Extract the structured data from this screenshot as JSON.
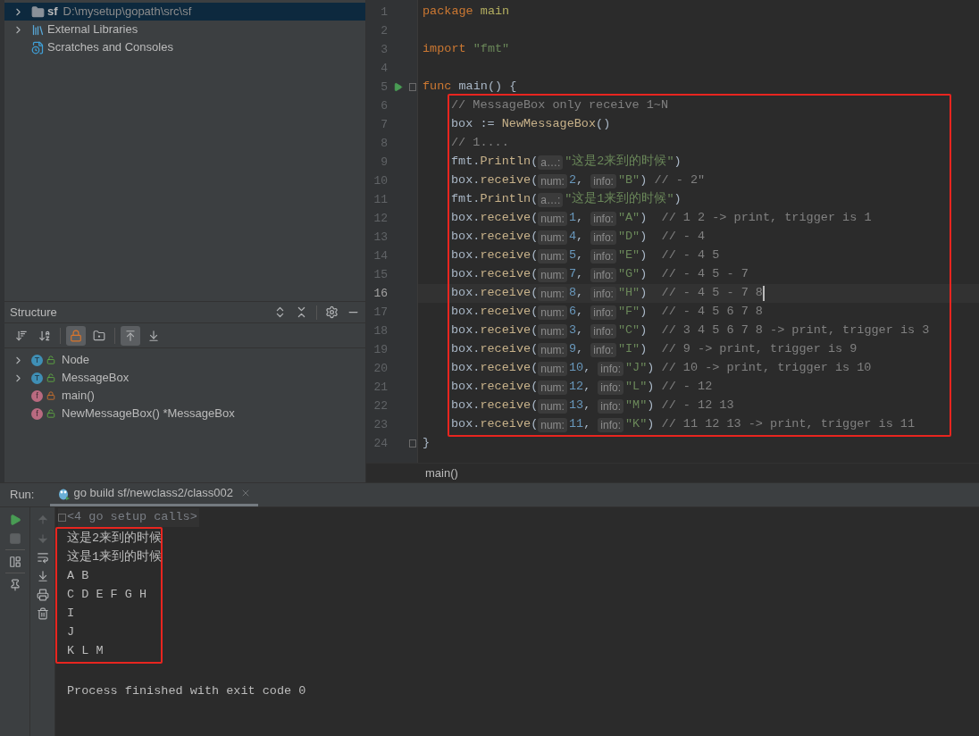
{
  "project_tree": {
    "items": [
      {
        "kind": "folder",
        "label": "sf",
        "path": "D:\\mysetup\\gopath\\src\\sf",
        "expandable": true,
        "selected": true
      },
      {
        "kind": "libraries",
        "label": "External Libraries",
        "expandable": true,
        "selected": false
      },
      {
        "kind": "scratches",
        "label": "Scratches and Consoles",
        "expandable": false,
        "selected": false
      }
    ]
  },
  "structure": {
    "title": "Structure",
    "toggles": [
      {
        "kind": "sort-visibility",
        "selected": false
      },
      {
        "kind": "sort-alpha",
        "selected": false
      },
      {
        "kind": "show-private",
        "selected": true
      },
      {
        "kind": "show-fields",
        "selected": false
      },
      {
        "kind": "scroll-to-source",
        "selected": true
      },
      {
        "kind": "scroll-from-source",
        "selected": false
      }
    ],
    "items": [
      {
        "kind": "type",
        "badge": "T",
        "locked": false,
        "label": "Node",
        "expandable": true
      },
      {
        "kind": "type",
        "badge": "T",
        "locked": false,
        "label": "MessageBox",
        "expandable": true
      },
      {
        "kind": "func",
        "badge": "f",
        "locked": true,
        "label": "main()",
        "expandable": false
      },
      {
        "kind": "func",
        "badge": "f",
        "locked": false,
        "label": "NewMessageBox() *MessageBox",
        "expandable": false
      }
    ]
  },
  "editor": {
    "breadcrumb": "main()",
    "lines": [
      {
        "number": "1",
        "kind": "code",
        "current": false,
        "tokens": [
          {
            "kind": "keyword",
            "text": "package "
          },
          {
            "kind": "package",
            "text": "main"
          }
        ]
      },
      {
        "number": "2",
        "kind": "code",
        "current": false
      },
      {
        "number": "3",
        "kind": "code",
        "current": false,
        "tokens": [
          {
            "kind": "keyword",
            "text": "import "
          },
          {
            "kind": "string",
            "text": "\"fmt\""
          }
        ]
      },
      {
        "number": "4",
        "kind": "code",
        "current": false
      },
      {
        "number": "5",
        "kind": "entry",
        "current": false,
        "tokens": [
          {
            "kind": "keyword",
            "text": "func "
          },
          {
            "kind": "plain",
            "text": "main() {"
          }
        ],
        "children": [
          {
            "number": "6",
            "kind": "code",
            "current": false,
            "tokens": [
              {
                "kind": "comment",
                "text": "// MessageBox only receive 1~N"
              }
            ]
          },
          {
            "number": "7",
            "kind": "code",
            "current": false,
            "tokens": [
              {
                "kind": "plain",
                "text": "box := "
              },
              {
                "kind": "call",
                "text": "NewMessageBox"
              },
              {
                "kind": "plain",
                "text": "()"
              }
            ]
          },
          {
            "number": "8",
            "kind": "code",
            "current": false,
            "tokens": [
              {
                "kind": "comment",
                "text": "// 1...."
              }
            ]
          },
          {
            "number": "9",
            "kind": "code",
            "current": false,
            "tokens": [
              {
                "kind": "plain",
                "text": "fmt."
              },
              {
                "kind": "call",
                "text": "Println"
              },
              {
                "kind": "plain",
                "text": "("
              },
              {
                "kind": "hint",
                "text": "a…:"
              },
              {
                "kind": "string",
                "text": "\"这是2来到的时候\""
              },
              {
                "kind": "plain",
                "text": ")"
              }
            ]
          },
          {
            "number": "10",
            "kind": "code",
            "current": false,
            "tokens": [
              {
                "kind": "plain",
                "text": "box."
              },
              {
                "kind": "call",
                "text": "receive"
              },
              {
                "kind": "plain",
                "text": "("
              },
              {
                "kind": "hint",
                "text": "num:"
              },
              {
                "kind": "number",
                "text": "2"
              },
              {
                "kind": "plain",
                "text": ", "
              },
              {
                "kind": "hint",
                "text": "info:"
              },
              {
                "kind": "string",
                "text": "\"B\""
              },
              {
                "kind": "plain",
                "text": ") "
              },
              {
                "kind": "comment",
                "text": "// - 2\""
              }
            ]
          },
          {
            "number": "11",
            "kind": "code",
            "current": false,
            "tokens": [
              {
                "kind": "plain",
                "text": "fmt."
              },
              {
                "kind": "call",
                "text": "Println"
              },
              {
                "kind": "plain",
                "text": "("
              },
              {
                "kind": "hint",
                "text": "a…:"
              },
              {
                "kind": "string",
                "text": "\"这是1来到的时候\""
              },
              {
                "kind": "plain",
                "text": ")"
              }
            ]
          },
          {
            "number": "12",
            "kind": "code",
            "current": false,
            "tokens": [
              {
                "kind": "plain",
                "text": "box."
              },
              {
                "kind": "call",
                "text": "receive"
              },
              {
                "kind": "plain",
                "text": "("
              },
              {
                "kind": "hint",
                "text": "num:"
              },
              {
                "kind": "number",
                "text": "1"
              },
              {
                "kind": "plain",
                "text": ", "
              },
              {
                "kind": "hint",
                "text": "info:"
              },
              {
                "kind": "string",
                "text": "\"A\""
              },
              {
                "kind": "plain",
                "text": ")  "
              },
              {
                "kind": "comment",
                "text": "// 1 2 -> print, trigger is 1"
              }
            ]
          },
          {
            "number": "13",
            "kind": "code",
            "current": false,
            "tokens": [
              {
                "kind": "plain",
                "text": "box."
              },
              {
                "kind": "call",
                "text": "receive"
              },
              {
                "kind": "plain",
                "text": "("
              },
              {
                "kind": "hint",
                "text": "num:"
              },
              {
                "kind": "number",
                "text": "4"
              },
              {
                "kind": "plain",
                "text": ", "
              },
              {
                "kind": "hint",
                "text": "info:"
              },
              {
                "kind": "string",
                "text": "\"D\""
              },
              {
                "kind": "plain",
                "text": ")  "
              },
              {
                "kind": "comment",
                "text": "// - 4"
              }
            ]
          },
          {
            "number": "14",
            "kind": "code",
            "current": false,
            "tokens": [
              {
                "kind": "plain",
                "text": "box."
              },
              {
                "kind": "call",
                "text": "receive"
              },
              {
                "kind": "plain",
                "text": "("
              },
              {
                "kind": "hint",
                "text": "num:"
              },
              {
                "kind": "number",
                "text": "5"
              },
              {
                "kind": "plain",
                "text": ", "
              },
              {
                "kind": "hint",
                "text": "info:"
              },
              {
                "kind": "string",
                "text": "\"E\""
              },
              {
                "kind": "plain",
                "text": ")  "
              },
              {
                "kind": "comment",
                "text": "// - 4 5"
              }
            ]
          },
          {
            "number": "15",
            "kind": "code",
            "current": false,
            "tokens": [
              {
                "kind": "plain",
                "text": "box."
              },
              {
                "kind": "call",
                "text": "receive"
              },
              {
                "kind": "plain",
                "text": "("
              },
              {
                "kind": "hint",
                "text": "num:"
              },
              {
                "kind": "number",
                "text": "7"
              },
              {
                "kind": "plain",
                "text": ", "
              },
              {
                "kind": "hint",
                "text": "info:"
              },
              {
                "kind": "string",
                "text": "\"G\""
              },
              {
                "kind": "plain",
                "text": ")  "
              },
              {
                "kind": "comment",
                "text": "// - 4 5 - 7"
              }
            ]
          },
          {
            "number": "16",
            "kind": "code",
            "current": true,
            "tokens": [
              {
                "kind": "plain",
                "text": "box."
              },
              {
                "kind": "call",
                "text": "receive"
              },
              {
                "kind": "plain",
                "text": "("
              },
              {
                "kind": "hint",
                "text": "num:"
              },
              {
                "kind": "number",
                "text": "8"
              },
              {
                "kind": "plain",
                "text": ", "
              },
              {
                "kind": "hint",
                "text": "info:"
              },
              {
                "kind": "string",
                "text": "\"H\""
              },
              {
                "kind": "plain",
                "text": ")  "
              },
              {
                "kind": "comment",
                "text": "// - 4 5 - 7 8"
              }
            ]
          },
          {
            "number": "17",
            "kind": "code",
            "current": false,
            "tokens": [
              {
                "kind": "plain",
                "text": "box."
              },
              {
                "kind": "call",
                "text": "receive"
              },
              {
                "kind": "plain",
                "text": "("
              },
              {
                "kind": "hint",
                "text": "num:"
              },
              {
                "kind": "number",
                "text": "6"
              },
              {
                "kind": "plain",
                "text": ", "
              },
              {
                "kind": "hint",
                "text": "info:"
              },
              {
                "kind": "string",
                "text": "\"F\""
              },
              {
                "kind": "plain",
                "text": ")  "
              },
              {
                "kind": "comment",
                "text": "// - 4 5 6 7 8"
              }
            ]
          },
          {
            "number": "18",
            "kind": "code",
            "current": false,
            "tokens": [
              {
                "kind": "plain",
                "text": "box."
              },
              {
                "kind": "call",
                "text": "receive"
              },
              {
                "kind": "plain",
                "text": "("
              },
              {
                "kind": "hint",
                "text": "num:"
              },
              {
                "kind": "number",
                "text": "3"
              },
              {
                "kind": "plain",
                "text": ", "
              },
              {
                "kind": "hint",
                "text": "info:"
              },
              {
                "kind": "string",
                "text": "\"C\""
              },
              {
                "kind": "plain",
                "text": ")  "
              },
              {
                "kind": "comment",
                "text": "// 3 4 5 6 7 8 -> print, trigger is 3"
              }
            ]
          },
          {
            "number": "19",
            "kind": "code",
            "current": false,
            "tokens": [
              {
                "kind": "plain",
                "text": "box."
              },
              {
                "kind": "call",
                "text": "receive"
              },
              {
                "kind": "plain",
                "text": "("
              },
              {
                "kind": "hint",
                "text": "num:"
              },
              {
                "kind": "number",
                "text": "9"
              },
              {
                "kind": "plain",
                "text": ", "
              },
              {
                "kind": "hint",
                "text": "info:"
              },
              {
                "kind": "string",
                "text": "\"I\""
              },
              {
                "kind": "plain",
                "text": ")  "
              },
              {
                "kind": "comment",
                "text": "// 9 -> print, trigger is 9"
              }
            ]
          },
          {
            "number": "20",
            "kind": "code",
            "current": false,
            "tokens": [
              {
                "kind": "plain",
                "text": "box."
              },
              {
                "kind": "call",
                "text": "receive"
              },
              {
                "kind": "plain",
                "text": "("
              },
              {
                "kind": "hint",
                "text": "num:"
              },
              {
                "kind": "number",
                "text": "10"
              },
              {
                "kind": "plain",
                "text": ", "
              },
              {
                "kind": "hint",
                "text": "info:"
              },
              {
                "kind": "string",
                "text": "\"J\""
              },
              {
                "kind": "plain",
                "text": ") "
              },
              {
                "kind": "comment",
                "text": "// 10 -> print, trigger is 10"
              }
            ]
          },
          {
            "number": "21",
            "kind": "code",
            "current": false,
            "tokens": [
              {
                "kind": "plain",
                "text": "box."
              },
              {
                "kind": "call",
                "text": "receive"
              },
              {
                "kind": "plain",
                "text": "("
              },
              {
                "kind": "hint",
                "text": "num:"
              },
              {
                "kind": "number",
                "text": "12"
              },
              {
                "kind": "plain",
                "text": ", "
              },
              {
                "kind": "hint",
                "text": "info:"
              },
              {
                "kind": "string",
                "text": "\"L\""
              },
              {
                "kind": "plain",
                "text": ") "
              },
              {
                "kind": "comment",
                "text": "// - 12"
              }
            ]
          },
          {
            "number": "22",
            "kind": "code",
            "current": false,
            "tokens": [
              {
                "kind": "plain",
                "text": "box."
              },
              {
                "kind": "call",
                "text": "receive"
              },
              {
                "kind": "plain",
                "text": "("
              },
              {
                "kind": "hint",
                "text": "num:"
              },
              {
                "kind": "number",
                "text": "13"
              },
              {
                "kind": "plain",
                "text": ", "
              },
              {
                "kind": "hint",
                "text": "info:"
              },
              {
                "kind": "string",
                "text": "\"M\""
              },
              {
                "kind": "plain",
                "text": ") "
              },
              {
                "kind": "comment",
                "text": "// - 12 13"
              }
            ]
          },
          {
            "number": "23",
            "kind": "code",
            "current": false,
            "tokens": [
              {
                "kind": "plain",
                "text": "box."
              },
              {
                "kind": "call",
                "text": "receive"
              },
              {
                "kind": "plain",
                "text": "("
              },
              {
                "kind": "hint",
                "text": "num:"
              },
              {
                "kind": "number",
                "text": "11"
              },
              {
                "kind": "plain",
                "text": ", "
              },
              {
                "kind": "hint",
                "text": "info:"
              },
              {
                "kind": "string",
                "text": "\"K\""
              },
              {
                "kind": "plain",
                "text": ") "
              },
              {
                "kind": "comment",
                "text": "// 11 12 13 -> print, trigger is 11"
              }
            ]
          }
        ]
      },
      {
        "number": "24",
        "kind": "block-end",
        "current": false,
        "tokens": [
          {
            "kind": "plain",
            "text": "}"
          }
        ]
      }
    ]
  },
  "run_panel": {
    "label": "Run:",
    "tab": {
      "label": "go build sf/newclass2/class002",
      "selected": true
    },
    "run_toolbar": [
      {
        "kind": "rerun",
        "disabled": false
      },
      {
        "kind": "stop",
        "disabled": true
      },
      {
        "kind": "layout",
        "disabled": false
      },
      {
        "kind": "pin",
        "disabled": false
      }
    ],
    "console_toolbar": [
      {
        "kind": "up",
        "disabled": true
      },
      {
        "kind": "down",
        "disabled": true
      },
      {
        "kind": "wrap",
        "disabled": false
      },
      {
        "kind": "scroll-end",
        "disabled": false
      },
      {
        "kind": "print",
        "disabled": false
      },
      {
        "kind": "delete",
        "disabled": false
      }
    ],
    "console": {
      "folded": "<4 go setup calls>",
      "highlighted_output": [
        "这是2来到的时候",
        "这是1来到的时候",
        "A B",
        "C D E F G H",
        "I",
        "J",
        "K L M"
      ],
      "exit_message": "Process finished with exit code 0"
    }
  }
}
